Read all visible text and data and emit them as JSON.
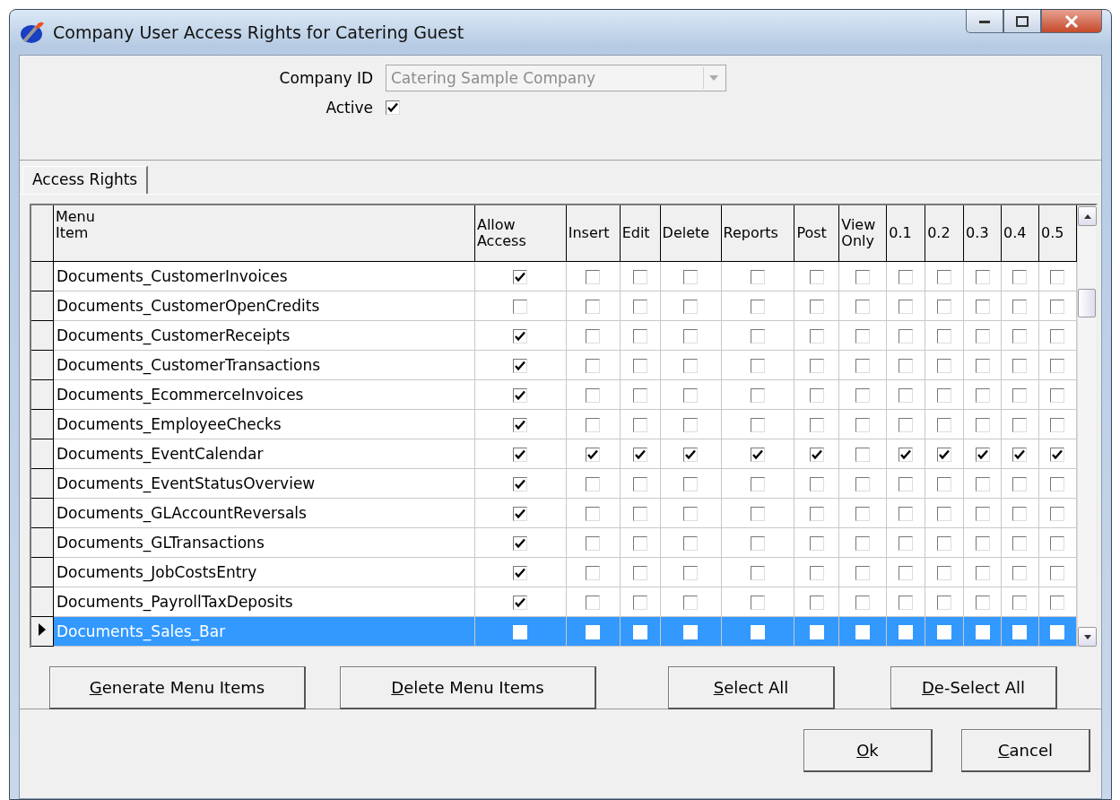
{
  "window": {
    "title": "Company User Access Rights for Catering Guest"
  },
  "company_id": {
    "label": "Company ID",
    "value": "Catering Sample Company",
    "disabled": true
  },
  "active": {
    "label": "Active",
    "checked": true
  },
  "tabs": [
    {
      "label": "Access Rights",
      "selected": true
    }
  ],
  "grid": {
    "columns": [
      {
        "label": "Menu Item",
        "kind": "text"
      },
      {
        "label": "Allow Access",
        "kind": "check"
      },
      {
        "label": "Insert",
        "kind": "check"
      },
      {
        "label": "Edit",
        "kind": "check"
      },
      {
        "label": "Delete",
        "kind": "check"
      },
      {
        "label": "Reports",
        "kind": "check"
      },
      {
        "label": "Post",
        "kind": "check"
      },
      {
        "label": "View Only",
        "kind": "check"
      },
      {
        "label": "0.1",
        "kind": "check"
      },
      {
        "label": "0.2",
        "kind": "check"
      },
      {
        "label": "0.3",
        "kind": "check"
      },
      {
        "label": "0.4",
        "kind": "check"
      },
      {
        "label": "0.5",
        "kind": "check"
      }
    ],
    "rows": [
      {
        "item": "Documents_CustomerInvoices",
        "selected": false,
        "checks": [
          true,
          false,
          false,
          false,
          false,
          false,
          false,
          false,
          false,
          false,
          false,
          false
        ]
      },
      {
        "item": "Documents_CustomerOpenCredits",
        "selected": false,
        "checks": [
          false,
          false,
          false,
          false,
          false,
          false,
          false,
          false,
          false,
          false,
          false,
          false
        ]
      },
      {
        "item": "Documents_CustomerReceipts",
        "selected": false,
        "checks": [
          true,
          false,
          false,
          false,
          false,
          false,
          false,
          false,
          false,
          false,
          false,
          false
        ]
      },
      {
        "item": "Documents_CustomerTransactions",
        "selected": false,
        "checks": [
          true,
          false,
          false,
          false,
          false,
          false,
          false,
          false,
          false,
          false,
          false,
          false
        ]
      },
      {
        "item": "Documents_EcommerceInvoices",
        "selected": false,
        "checks": [
          true,
          false,
          false,
          false,
          false,
          false,
          false,
          false,
          false,
          false,
          false,
          false
        ]
      },
      {
        "item": "Documents_EmployeeChecks",
        "selected": false,
        "checks": [
          true,
          false,
          false,
          false,
          false,
          false,
          false,
          false,
          false,
          false,
          false,
          false
        ]
      },
      {
        "item": "Documents_EventCalendar",
        "selected": false,
        "checks": [
          true,
          true,
          true,
          true,
          true,
          true,
          false,
          true,
          true,
          true,
          true,
          true
        ]
      },
      {
        "item": "Documents_EventStatusOverview",
        "selected": false,
        "checks": [
          true,
          false,
          false,
          false,
          false,
          false,
          false,
          false,
          false,
          false,
          false,
          false
        ]
      },
      {
        "item": "Documents_GLAccountReversals",
        "selected": false,
        "checks": [
          true,
          false,
          false,
          false,
          false,
          false,
          false,
          false,
          false,
          false,
          false,
          false
        ]
      },
      {
        "item": "Documents_GLTransactions",
        "selected": false,
        "checks": [
          true,
          false,
          false,
          false,
          false,
          false,
          false,
          false,
          false,
          false,
          false,
          false
        ]
      },
      {
        "item": "Documents_JobCostsEntry",
        "selected": false,
        "checks": [
          true,
          false,
          false,
          false,
          false,
          false,
          false,
          false,
          false,
          false,
          false,
          false
        ]
      },
      {
        "item": "Documents_PayrollTaxDeposits",
        "selected": false,
        "checks": [
          true,
          false,
          false,
          false,
          false,
          false,
          false,
          false,
          false,
          false,
          false,
          false
        ]
      },
      {
        "item": "Documents_Sales_Bar",
        "selected": true,
        "checks": [
          false,
          false,
          false,
          false,
          false,
          false,
          false,
          false,
          false,
          false,
          false,
          false
        ]
      }
    ]
  },
  "grid_buttons": [
    "Generate Menu Items",
    "Delete Menu Items",
    "Select All",
    "De-Select All"
  ],
  "dialog_buttons": [
    "Ok",
    "Cancel"
  ]
}
